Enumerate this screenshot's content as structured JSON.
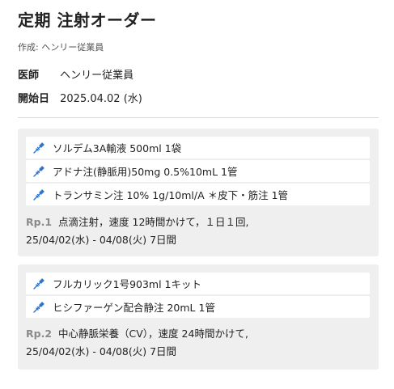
{
  "header": {
    "title": "定期 注射オーダー",
    "author": "作成: ヘンリー従業員"
  },
  "meta": {
    "doctor_label": "医師",
    "doctor_value": "ヘンリー従業員",
    "start_label": "開始日",
    "start_value": "2025.04.02 (水)"
  },
  "prescriptions": [
    {
      "rp_number": "Rp.1",
      "drugs": [
        {
          "label": "ソルデム3A輸液 500ml  1袋",
          "icon": "syringe-icon"
        },
        {
          "label": "アドナ注(静脈用)50mg 0.5%10mL  1管",
          "icon": "syringe-icon"
        },
        {
          "label": "トランサミン注 10% 1g/10ml/A ＊皮下・筋注  1管",
          "icon": "syringe-icon"
        }
      ],
      "instructions": "点滴注射，速度 12時間かけて，１日１回,",
      "period": "25/04/02(水) - 04/08(火) 7日間"
    },
    {
      "rp_number": "Rp.2",
      "drugs": [
        {
          "label": "フルカリック1号903ml  1キット",
          "icon": "syringe-icon"
        },
        {
          "label": "ヒシファーゲン配合静注 20mL  1管",
          "icon": "syringe-icon"
        }
      ],
      "instructions": "中心静脈栄養（CV），速度 24時間かけて,",
      "period": "25/04/02(水) - 04/08(火) 7日間"
    }
  ],
  "colors": {
    "accent_icon": "#2a72c9",
    "block_bg": "#efefef",
    "rp_number": "#8a8a8a"
  }
}
